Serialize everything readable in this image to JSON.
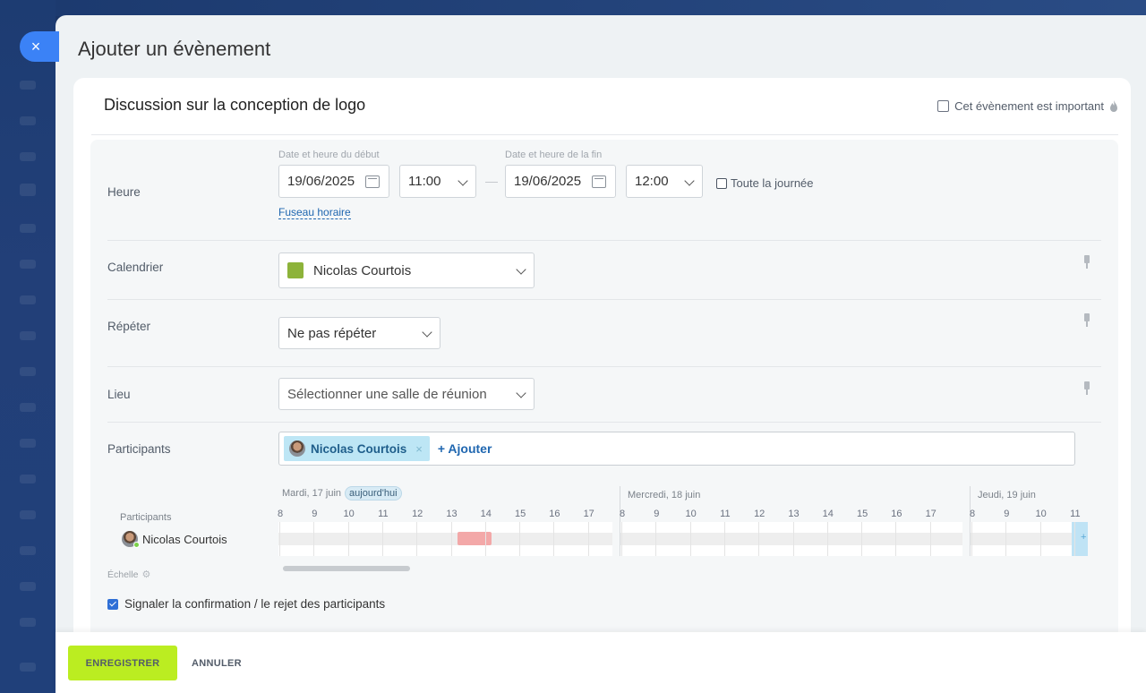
{
  "page_title": "Ajouter un évènement",
  "event": {
    "name": "Discussion sur la conception de logo",
    "important_label": "Cet évènement est important",
    "important_checked": false
  },
  "time": {
    "label": "Heure",
    "start_label": "Date et heure du début",
    "start_date": "19/06/2025",
    "start_time": "11:00",
    "end_label": "Date et heure de la fin",
    "end_date": "19/06/2025",
    "end_time": "12:00",
    "separator": "—",
    "all_day_label": "Toute la journée",
    "all_day_checked": false,
    "timezone_link": "Fuseau horaire",
    "calendar_icon_day": "24"
  },
  "calendar": {
    "label": "Calendrier",
    "value": "Nicolas Courtois",
    "color": "#8db33a"
  },
  "repeat": {
    "label": "Répéter",
    "value": "Ne pas répéter"
  },
  "location": {
    "label": "Lieu",
    "placeholder": "Sélectionner une salle de réunion"
  },
  "participants": {
    "label": "Participants",
    "chips": [
      {
        "name": "Nicolas Courtois",
        "remove": "×"
      }
    ],
    "add_label": "+ Ajouter"
  },
  "timeline": {
    "side_label": "Participants",
    "person": "Nicolas Courtois",
    "scale_label": "Échelle",
    "days": [
      {
        "label": "Mardi, 17 juin",
        "today_badge": "aujourd'hui",
        "hours": [
          "8",
          "9",
          "10",
          "11",
          "12",
          "13",
          "14",
          "15",
          "16",
          "17"
        ]
      },
      {
        "label": "Mercredi, 18 juin",
        "hours": [
          "8",
          "9",
          "10",
          "11",
          "12",
          "13",
          "14",
          "15",
          "16",
          "17"
        ]
      },
      {
        "label": "Jeudi, 19 juin",
        "hours": [
          "8",
          "9",
          "10",
          "11"
        ]
      }
    ],
    "busy": [
      {
        "day": "Mardi, 17 juin",
        "from": "13:30",
        "to": "14:30"
      }
    ],
    "selected": {
      "day": "Jeudi, 19 juin",
      "from": "11:00",
      "to": "12:00",
      "marker": "+"
    }
  },
  "notify": {
    "label": "Signaler la confirmation / le rejet des participants",
    "checked": true
  },
  "footer": {
    "save_label": "ENREGISTRER",
    "cancel_label": "ANNULER"
  },
  "close_icon": "×",
  "colors": {
    "save_button": "#bbed21",
    "link": "#2067b0",
    "busy": "#f3a8a8",
    "chip": "#bde6f5"
  }
}
